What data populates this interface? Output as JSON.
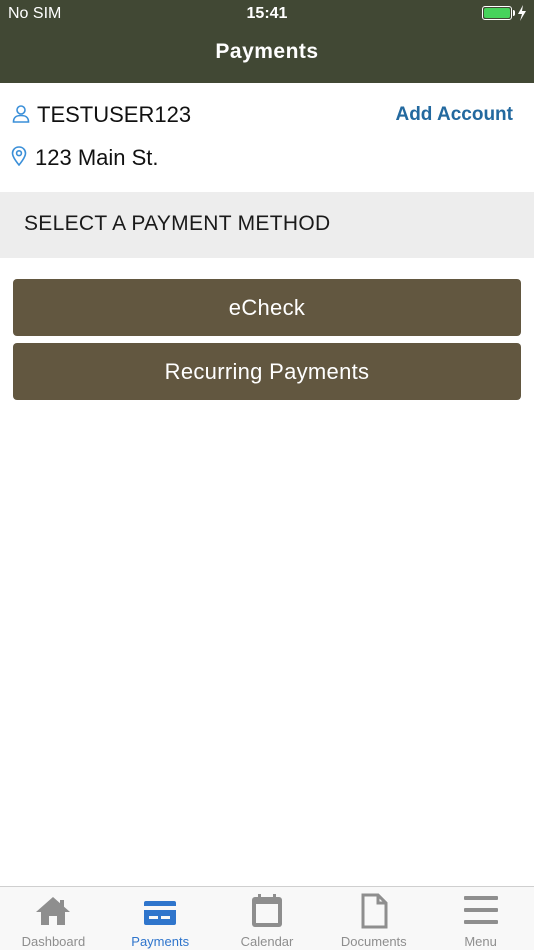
{
  "status_bar": {
    "carrier": "No SIM",
    "time": "15:41",
    "battery_level": 1.0
  },
  "header": {
    "title": "Payments"
  },
  "account": {
    "username": "TESTUSER123",
    "user_icon": "user-icon",
    "add_account_label": "Add Account",
    "address": "123 Main St.",
    "address_icon": "location-pin-icon"
  },
  "section": {
    "title": "SELECT A PAYMENT METHOD"
  },
  "payment_methods": [
    {
      "label": "eCheck"
    },
    {
      "label": "Recurring Payments"
    }
  ],
  "tab_bar": {
    "active": "Payments",
    "tabs": [
      {
        "label": "Dashboard",
        "icon": "house-icon"
      },
      {
        "label": "Payments",
        "icon": "credit-card-icon"
      },
      {
        "label": "Calendar",
        "icon": "calendar-icon"
      },
      {
        "label": "Documents",
        "icon": "document-icon"
      },
      {
        "label": "Menu",
        "icon": "hamburger-menu-icon"
      }
    ]
  },
  "colors": {
    "header_bg": "#414834",
    "button_bg": "#625740",
    "link": "#23699f",
    "tab_active": "#2f75cc",
    "tab_inactive": "#8e8e8e",
    "battery": "#46d35b"
  }
}
